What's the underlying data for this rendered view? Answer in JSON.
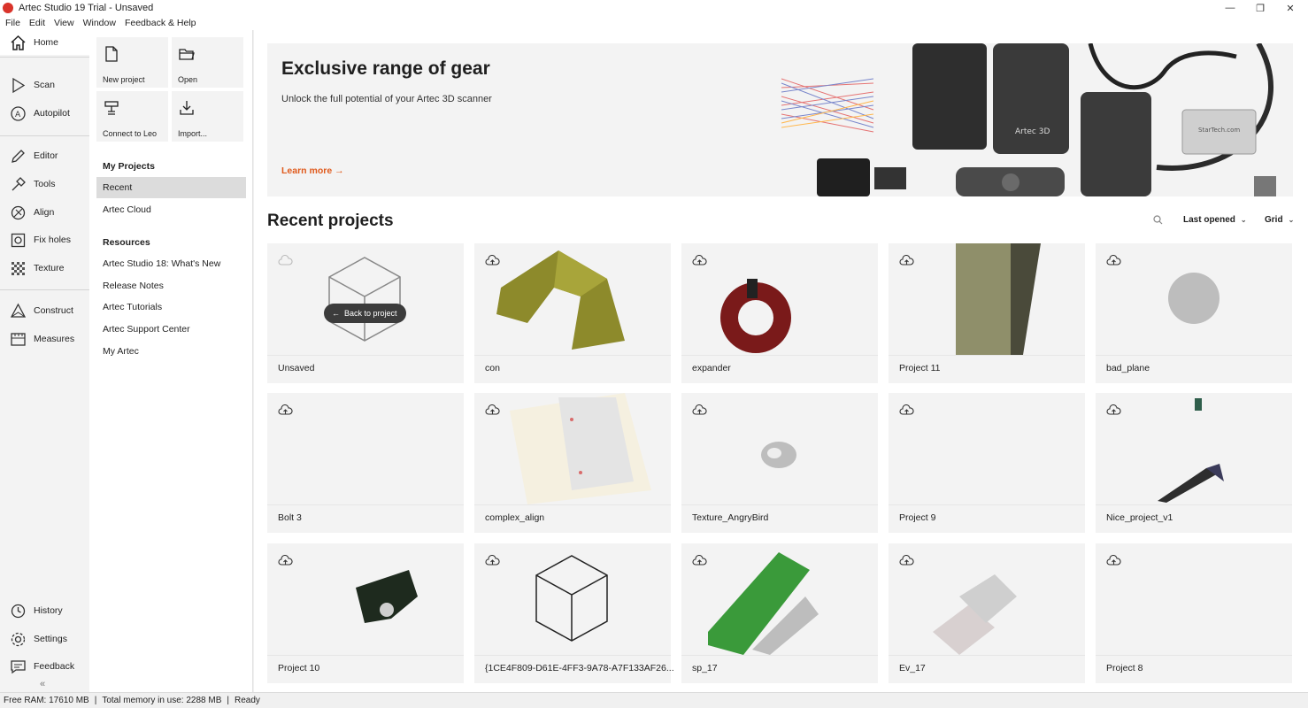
{
  "window": {
    "title": "Artec Studio 19 Trial - Unsaved",
    "minimize": "—",
    "maximize": "❐",
    "close": "✕"
  },
  "menu": [
    "File",
    "Edit",
    "View",
    "Window",
    "Feedback & Help"
  ],
  "leftnav": {
    "items": [
      {
        "label": "Home",
        "icon": "home-icon"
      },
      {
        "label": "Scan",
        "icon": "play-icon"
      },
      {
        "label": "Autopilot",
        "icon": "autopilot-icon"
      },
      {
        "label": "Editor",
        "icon": "pencil-icon"
      },
      {
        "label": "Tools",
        "icon": "tools-icon"
      },
      {
        "label": "Align",
        "icon": "align-icon"
      },
      {
        "label": "Fix holes",
        "icon": "fix-holes-icon"
      },
      {
        "label": "Texture",
        "icon": "texture-icon"
      },
      {
        "label": "Construct",
        "icon": "construct-icon"
      },
      {
        "label": "Measures",
        "icon": "measures-icon"
      },
      {
        "label": "History",
        "icon": "history-icon"
      },
      {
        "label": "Settings",
        "icon": "gear-icon"
      },
      {
        "label": "Feedback",
        "icon": "feedback-icon"
      }
    ],
    "collapse": "«"
  },
  "secondnav": {
    "tiles": [
      {
        "label": "New project",
        "icon": "new-file-icon"
      },
      {
        "label": "Open",
        "icon": "folder-icon"
      },
      {
        "label": "Connect to Leo",
        "icon": "leo-scanner-icon"
      },
      {
        "label": "Import...",
        "icon": "import-icon"
      }
    ],
    "my_projects_heading": "My Projects",
    "my_projects": [
      "Recent",
      "Artec Cloud"
    ],
    "resources_heading": "Resources",
    "resources": [
      "Artec Studio 18: What's New",
      "Release Notes",
      "Artec Tutorials",
      "Artec Support Center",
      "My Artec"
    ]
  },
  "banner": {
    "title": "Exclusive range of gear",
    "subtitle": "Unlock the full potential of your Artec 3D scanner",
    "link": "Learn more",
    "link_arrow": "→",
    "product_label": "Artec 3D",
    "hub_label": "StarTech.com"
  },
  "recent": {
    "title": "Recent projects",
    "sort": "Last opened",
    "view": "Grid",
    "back_to_project": "Back to project",
    "projects": [
      "Unsaved",
      "con",
      "expander",
      "Project 11",
      "bad_plane",
      "Bolt 3",
      "complex_align",
      "Texture_AngryBird",
      "Project 9",
      "Nice_project_v1",
      "Project 10",
      "{1CE4F809-D61E-4FF3-9A78-A7F133AF26...",
      "sp_17",
      "Ev_17",
      "Project 8"
    ]
  },
  "status": {
    "free_ram": "Free RAM: 17610 MB",
    "sep1": "|",
    "total_memory": "Total memory in use: 2288 MB",
    "sep2": "|",
    "state": "Ready"
  },
  "colors": {
    "accent": "#e05a1c",
    "logo": "#d9332a",
    "sidebar_bg": "#f3f3f3"
  }
}
